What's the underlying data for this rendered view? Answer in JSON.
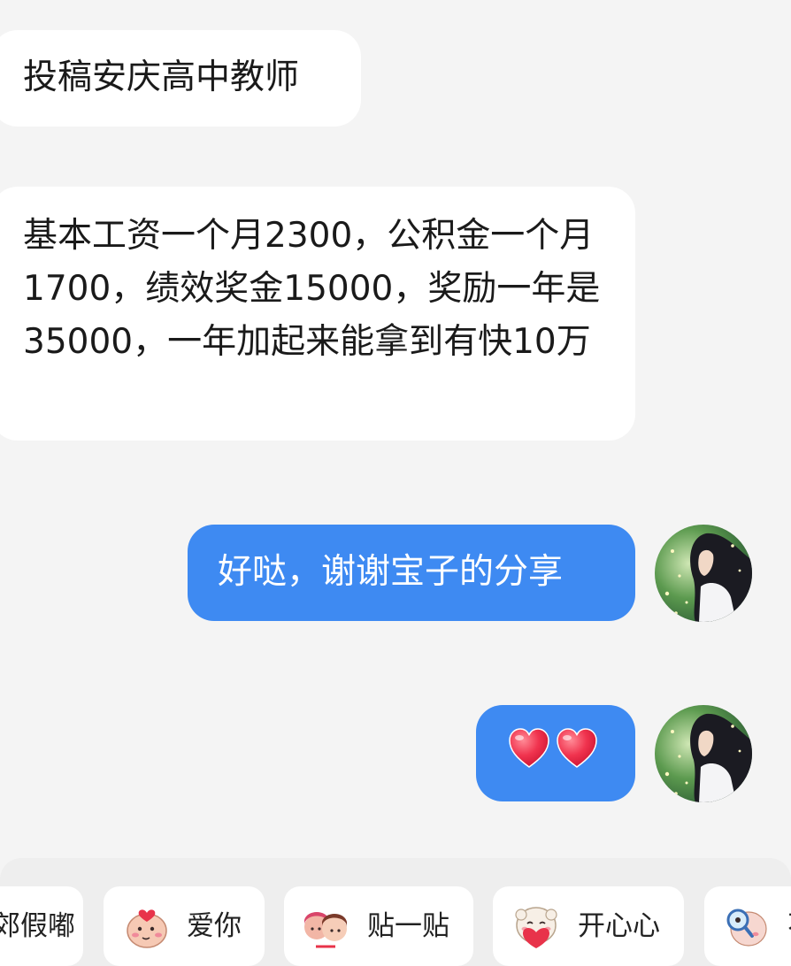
{
  "messages": [
    {
      "sender": "other",
      "text": "投稿安庆高中教师"
    },
    {
      "sender": "other",
      "text": "基本工资一个月2300，公积金一个月1700，绩效奖金15000，奖励一年是35000，一年加起来能拿到有快10万"
    },
    {
      "sender": "me",
      "text": "好哒，谢谢宝子的分享"
    },
    {
      "sender": "me",
      "content": [
        "heart-emoji",
        "heart-emoji"
      ]
    }
  ],
  "sticker_bar": {
    "chips": [
      {
        "label": "郊假嘟",
        "icon": null
      },
      {
        "label": "爱你",
        "icon": "love-sticker"
      },
      {
        "label": "贴一贴",
        "icon": "hug-sticker"
      },
      {
        "label": "开心心",
        "icon": "happy-sticker"
      },
      {
        "label": "不",
        "icon": "magnifier-sticker"
      }
    ]
  },
  "colors": {
    "background": "#f4f4f4",
    "incoming_bubble": "#ffffff",
    "outgoing_bubble": "#3e8af2",
    "heart": "#f0334e"
  }
}
